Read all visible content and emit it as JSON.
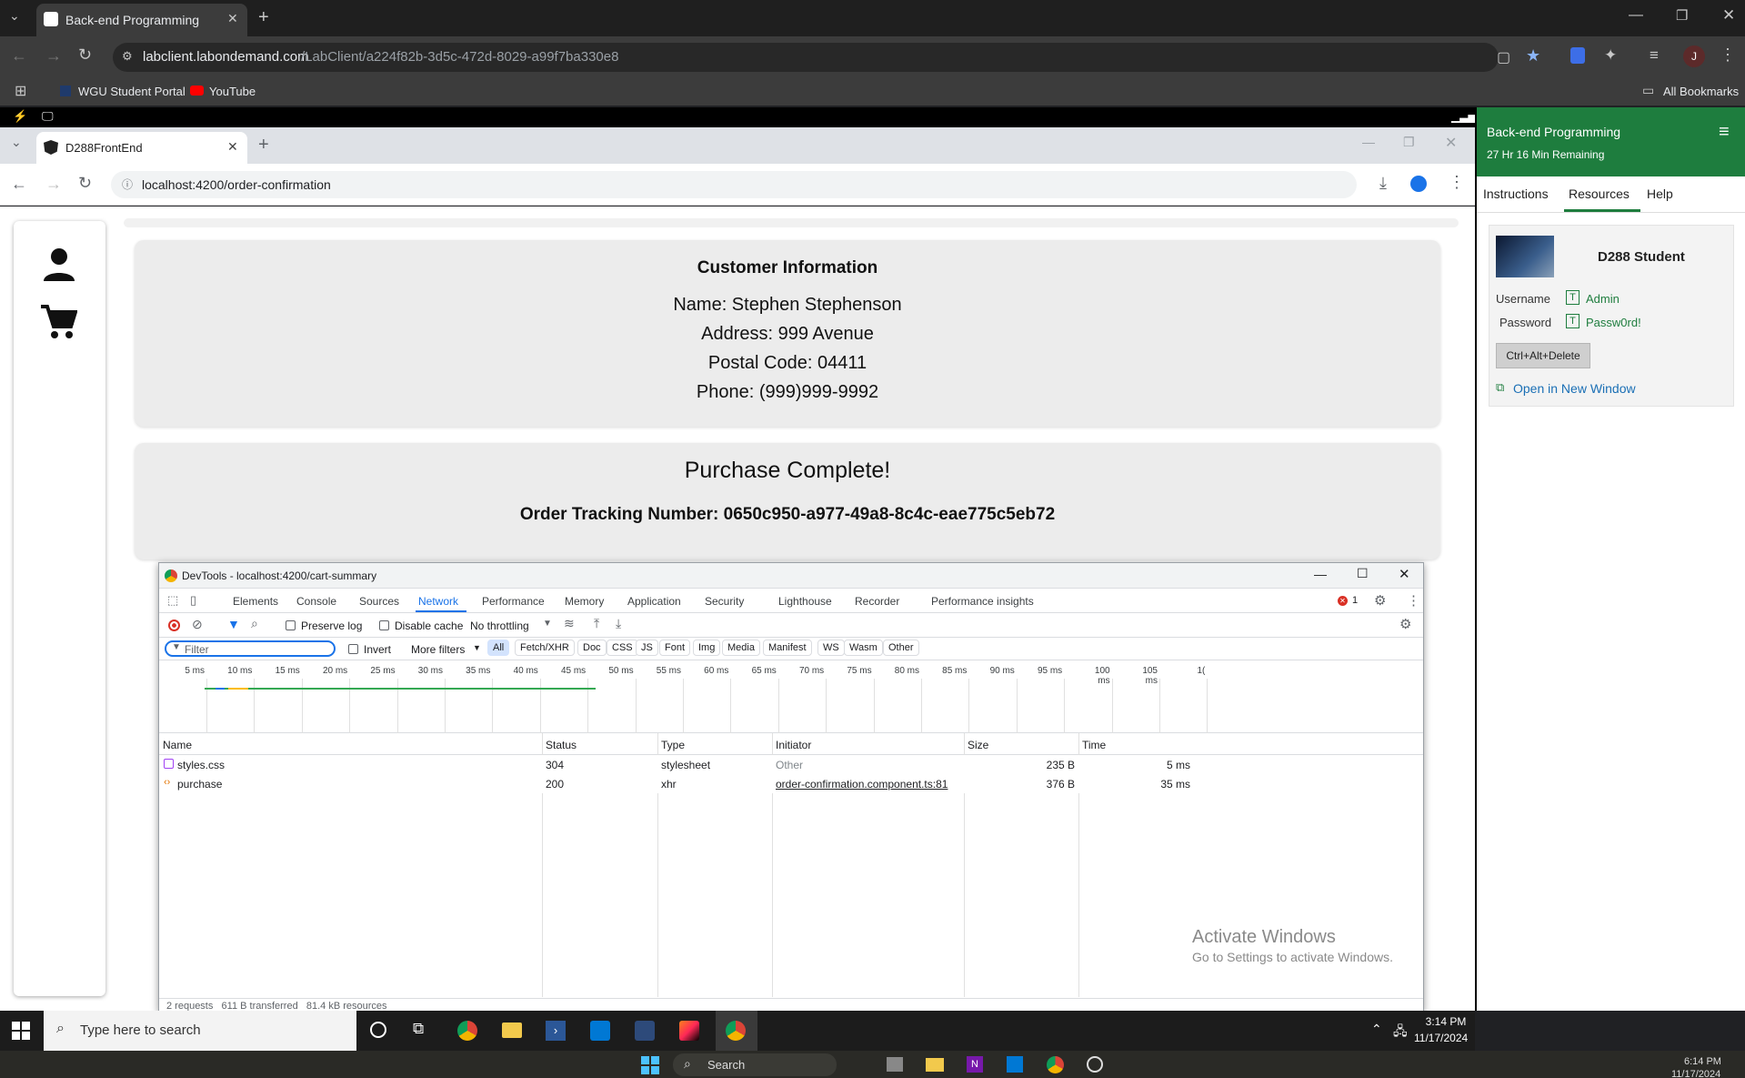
{
  "outer": {
    "tab_title": "Back-end Programming",
    "url_domain": "labclient.labondemand.com",
    "url_path": "/LabClient/a224f82b-3d5c-472d-8029-a99f7ba330e8",
    "bookmarks": [
      "WGU Student Portal",
      "YouTube"
    ],
    "all_bookmarks": "All Bookmarks",
    "profile_initial": "J"
  },
  "inner": {
    "tab_title": "D288FrontEnd",
    "url": "localhost:4200/order-confirmation"
  },
  "customer": {
    "heading": "Customer Information",
    "name": "Name: Stephen Stephenson",
    "address": "Address: 999 Avenue",
    "postal": "Postal Code: 04411",
    "phone": "Phone: (999)999-9992"
  },
  "purchase": {
    "heading": "Purchase Complete!",
    "tracking": "Order Tracking Number: 0650c950-a977-49a8-8c4c-eae775c5eb72"
  },
  "devtools": {
    "title": "DevTools - localhost:4200/cart-summary",
    "tabs": [
      "Elements",
      "Console",
      "Sources",
      "Network",
      "Performance",
      "Memory",
      "Application",
      "Security",
      "Lighthouse",
      "Recorder",
      "Performance insights"
    ],
    "active_tab": "Network",
    "error_count": "1",
    "preserve_log": "Preserve log",
    "disable_cache": "Disable cache",
    "throttling": "No throttling",
    "filter_placeholder": "Filter",
    "invert": "Invert",
    "more_filters": "More filters",
    "filter_chips": [
      "All",
      "Fetch/XHR",
      "Doc",
      "CSS",
      "JS",
      "Font",
      "Img",
      "Media",
      "Manifest",
      "WS",
      "Wasm",
      "Other"
    ],
    "timeline_ticks": [
      "5 ms",
      "10 ms",
      "15 ms",
      "20 ms",
      "25 ms",
      "30 ms",
      "35 ms",
      "40 ms",
      "45 ms",
      "50 ms",
      "55 ms",
      "60 ms",
      "65 ms",
      "70 ms",
      "75 ms",
      "80 ms",
      "85 ms",
      "90 ms",
      "95 ms",
      "100 ms",
      "105 ms",
      "1("
    ],
    "columns": [
      "Name",
      "Status",
      "Type",
      "Initiator",
      "Size",
      "Time"
    ],
    "rows": [
      {
        "name": "styles.css",
        "status": "304",
        "type": "stylesheet",
        "initiator": "Other",
        "size": "235 B",
        "time": "5 ms"
      },
      {
        "name": "purchase",
        "status": "200",
        "type": "xhr",
        "initiator": "order-confirmation.component.ts:81",
        "size": "376 B",
        "time": "35 ms"
      }
    ],
    "footer": "2 requests   611 B transferred   81.4 kB resources"
  },
  "watermark": {
    "line1": "Activate Windows",
    "line2": "Go to Settings to activate Windows."
  },
  "taskbar": {
    "search_placeholder": "Type here to search",
    "time": "3:14 PM",
    "date": "11/17/2024"
  },
  "host_taskbar": {
    "search": "Search",
    "time": "6:14 PM",
    "date": "11/17/2024"
  },
  "lab": {
    "title": "Back-end Programming",
    "remaining": "27 Hr 16 Min Remaining",
    "nav": [
      "Instructions",
      "Resources",
      "Help"
    ],
    "active_nav": "Resources",
    "student": "D288 Student",
    "username_label": "Username",
    "username": "Admin",
    "password_label": "Password",
    "password": "Passw0rd!",
    "cad_button": "Ctrl+Alt+Delete",
    "open_new": "Open in New Window"
  }
}
